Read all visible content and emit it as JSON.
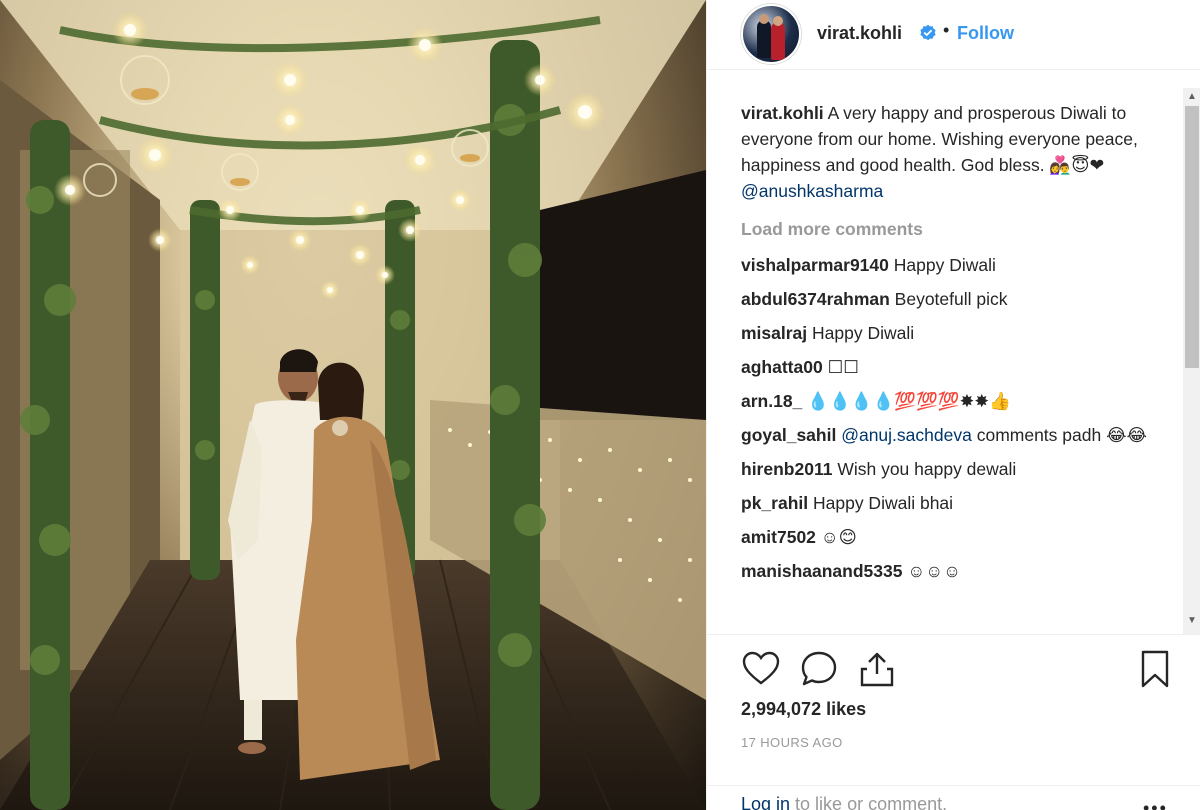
{
  "post": {
    "username": "virat.kohli",
    "follow_label": "Follow",
    "separator": "•",
    "caption_user": "virat.kohli",
    "caption_text": " A very happy and prosperous Diwali to everyone from our home. Wishing everyone peace, happiness and good health. God bless. 👩‍❤️‍👨😇❤ ",
    "caption_mention": "@anushkasharma",
    "load_more": "Load more comments",
    "likes": "2,994,072 likes",
    "time": "17 HOURS AGO",
    "login_link": "Log in",
    "login_rest": " to like or comment.",
    "more_label": "•••"
  },
  "comments": [
    {
      "user": "vishalparmar9140",
      "text": " Happy Diwali",
      "mention": "",
      "after": ""
    },
    {
      "user": "abdul6374rahman",
      "text": " Beyotefull pick",
      "mention": "",
      "after": ""
    },
    {
      "user": "misalraj",
      "text": " Happy Diwali",
      "mention": "",
      "after": ""
    },
    {
      "user": "aghatta00",
      "text": " ☐☐",
      "mention": "",
      "after": ""
    },
    {
      "user": "arn.18_",
      "text": " 💧💧💧💧💯💯💯✸✸👍",
      "mention": "",
      "after": ""
    },
    {
      "user": "goyal_sahil",
      "text": " ",
      "mention": "@anuj.sachdeva",
      "after": " comments padh 😂😂"
    },
    {
      "user": "hirenb2011",
      "text": " Wish you happy dewali",
      "mention": "",
      "after": ""
    },
    {
      "user": "pk_rahil",
      "text": " Happy Diwali bhai",
      "mention": "",
      "after": ""
    },
    {
      "user": "amit7502",
      "text": " ☺😊",
      "mention": "",
      "after": ""
    },
    {
      "user": "manishaanand5335",
      "text": " ☺☺☺",
      "mention": "",
      "after": ""
    }
  ],
  "colors": {
    "link": "#3897f0",
    "mention": "#003569",
    "muted": "#999999",
    "text": "#262626"
  },
  "icons": [
    "verified-badge-icon",
    "heart-icon",
    "comment-icon",
    "share-icon",
    "bookmark-icon",
    "scroll-up-arrow-icon",
    "scroll-down-arrow-icon"
  ]
}
